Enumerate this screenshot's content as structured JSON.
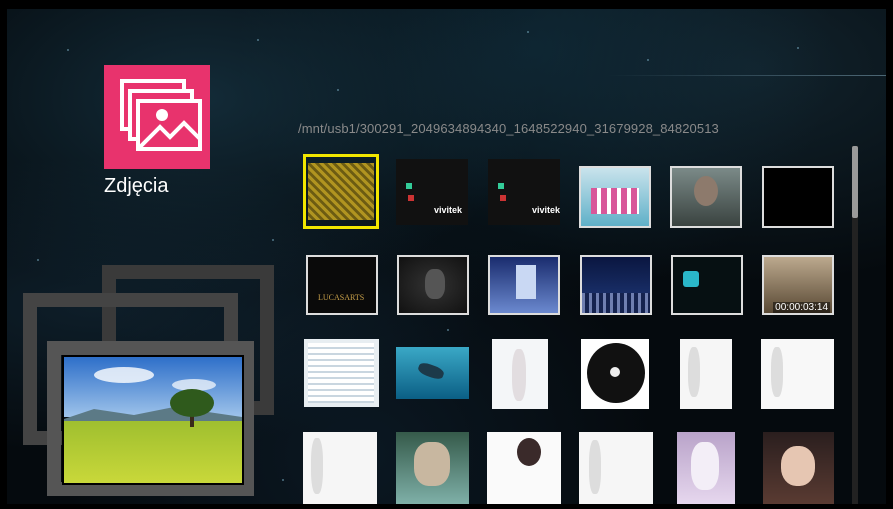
{
  "app": {
    "title": "Zdjęcia",
    "accent_color": "#e8336d"
  },
  "browser": {
    "path": "/mnt/usb1/300291_2049634894340_1648522940_31679928_84820513",
    "selection_color": "#f2e600"
  },
  "grid": {
    "brand": "vivitek",
    "lucasarts": "LUCASARTS",
    "timecode": "00:00:03:14"
  }
}
